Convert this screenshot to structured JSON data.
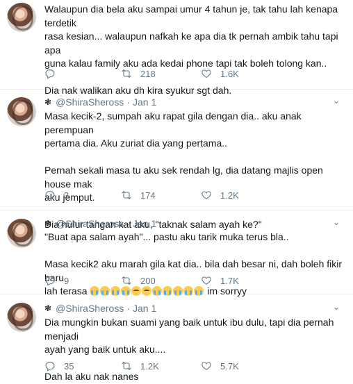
{
  "tweets": [
    {
      "has_header": false,
      "lines": [
        "Walaupun dia bela aku sampai umur 4 tahun je, tak tahu lah kenapa terdetik",
        "rasa kesian... walaupun nafkah ke apa dia tk pernah ambik tahu tapi apa",
        "guna kalau family aku ada kedai phone tapi tak boleh tolong kan..",
        "",
        "Dia nak walikan aku dh kira syukur sgt dah."
      ],
      "replies": "",
      "retweets": "218",
      "likes": "1.6K"
    },
    {
      "has_header": true,
      "handle": "@ShiraSheross",
      "date": "Jan 1",
      "lines": [
        "Masa kecik-2, sumpah aku rapat gila dengan dia.. aku anak perempuan",
        "pertama dia. Aku zuriat dia yang pertama..",
        "",
        "Pernah sekali masa tu aku sek rendah lg, dia datang majlis open house mak",
        "aku jemput.",
        "",
        "Dia hulur tangan kat aku, \"taknak salam ayah ke?\""
      ],
      "replies": "3",
      "retweets": "174",
      "likes": "1.2K"
    },
    {
      "has_header": true,
      "handle": "@ShiraSheross",
      "date": "Jan 1",
      "lines": [
        "\"Buat apa salam ayah\"... pastu aku tarik muka terus bla..",
        "",
        "Masa kecik2 aku marah gila kat dia.. bila dah besar ni, dah boleh fikir baru"
      ],
      "last_line_prefix": "lah terasa",
      "last_line_suffix": " im sorryy",
      "replies": "9",
      "retweets": "200",
      "likes": "1.7K"
    },
    {
      "has_header": true,
      "handle": "@ShiraSheross",
      "date": "Jan 1",
      "lines": [
        "Dia mungkin bukan suami yang baik untuk ibu dulu, tapi dia pernah menjadi",
        "ayah yang baik untuk aku....",
        "",
        "Dah la aku nak nanes"
      ],
      "replies": "35",
      "retweets": "1.2K",
      "likes": "5.7K"
    }
  ],
  "icons": {
    "header_mark": "flower-icon",
    "menu": "chevron-down-icon",
    "reply": "reply-icon",
    "retweet": "retweet-icon",
    "like": "heart-icon"
  }
}
